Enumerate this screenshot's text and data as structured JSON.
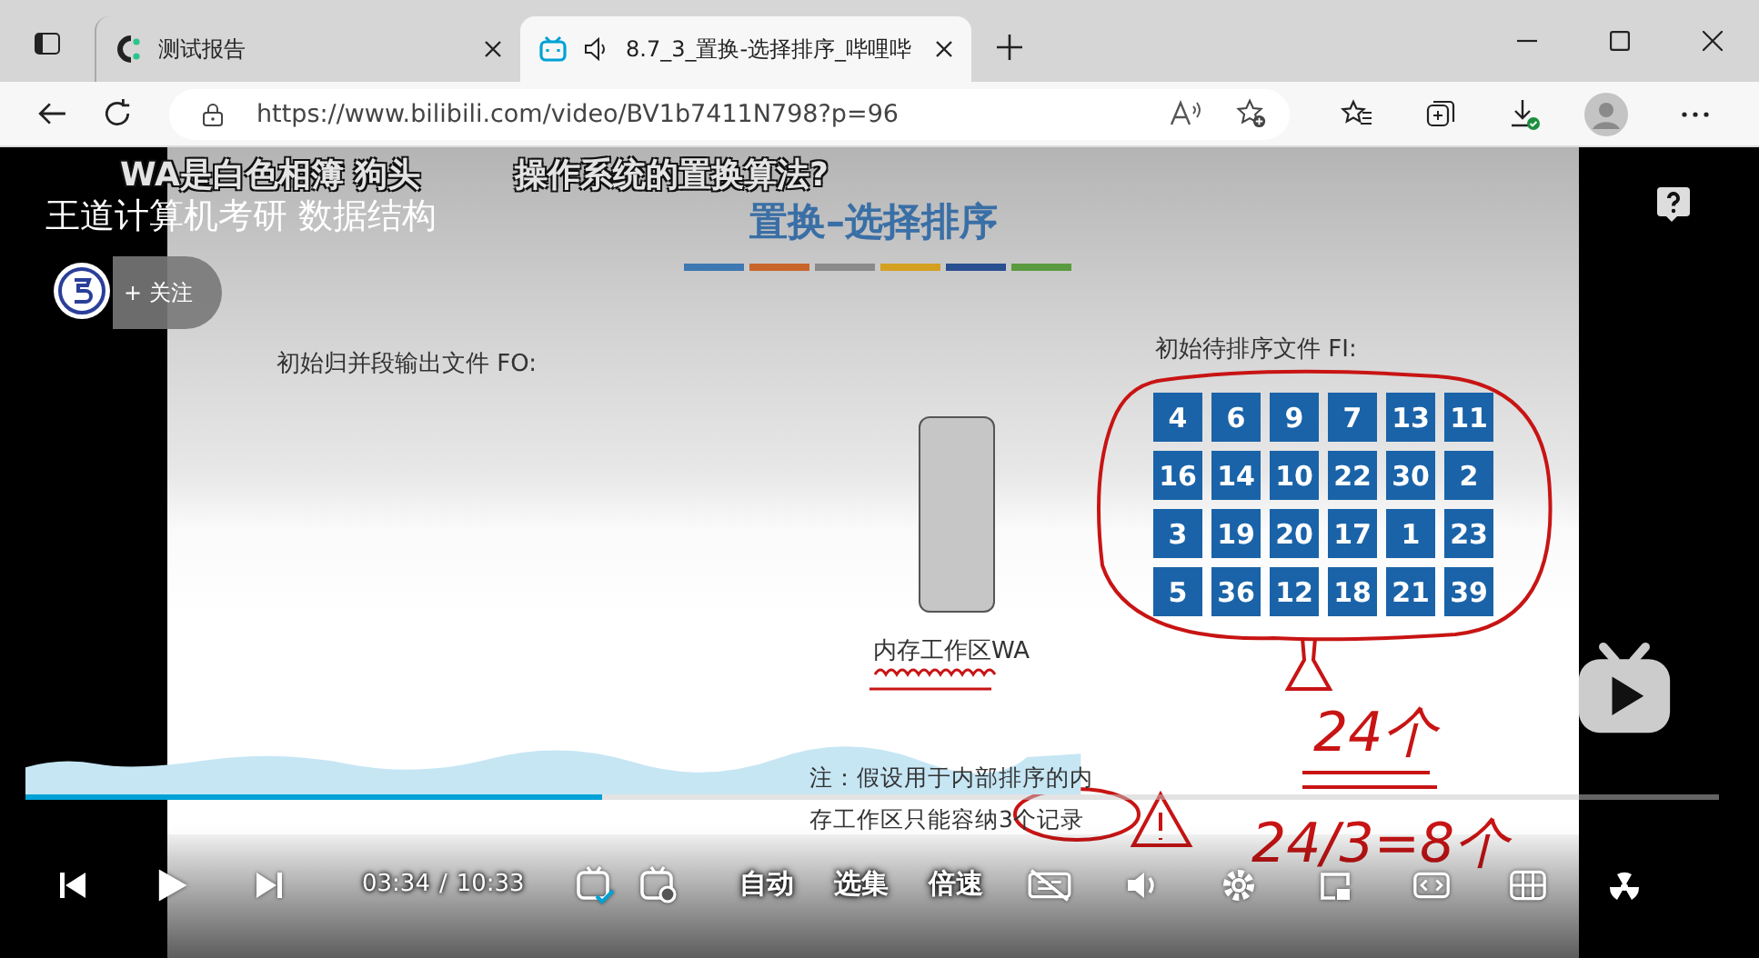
{
  "browser": {
    "tabs": [
      {
        "title": "测试报告",
        "selected": false,
        "audio": false
      },
      {
        "title": "8.7_3_置换-选择排序_哔哩哔",
        "selected": true,
        "audio": true
      }
    ],
    "url": "https://www.bilibili.com/video/BV1b7411N798?p=96"
  },
  "video": {
    "danmaku": [
      "WA是白色相簿 狗头",
      "操作系统的置换算法?"
    ],
    "uploader_title": "王道计算机考研 数据结构",
    "follow_label": "+ 关注",
    "slide": {
      "title": "置换–选择排序",
      "output_label": "初始归并段输出文件 FO:",
      "input_label": "初始待排序文件 FI:",
      "grid_rows": [
        {
          "cells": [
            "4",
            "6",
            "9",
            "7",
            "13",
            "11"
          ]
        },
        {
          "cells": [
            "16",
            "14",
            "10",
            "22",
            "30",
            "2"
          ]
        },
        {
          "cells": [
            "3",
            "19",
            "20",
            "17",
            "1",
            "23"
          ]
        },
        {
          "cells": [
            "5",
            "36",
            "12",
            "18",
            "21",
            "39"
          ]
        }
      ],
      "wa_label": "内存工作区WA",
      "note": [
        "注：假设用于内部排序的内",
        "存工作区只能容纳3个记录"
      ]
    },
    "annotations": [
      "24个",
      "24/3=8个"
    ],
    "player": {
      "level": 0.34,
      "current_time": "03:34",
      "separator": "/",
      "duration": "10:33",
      "text_buttons": [
        "自动",
        "选集",
        "倍速"
      ]
    }
  }
}
